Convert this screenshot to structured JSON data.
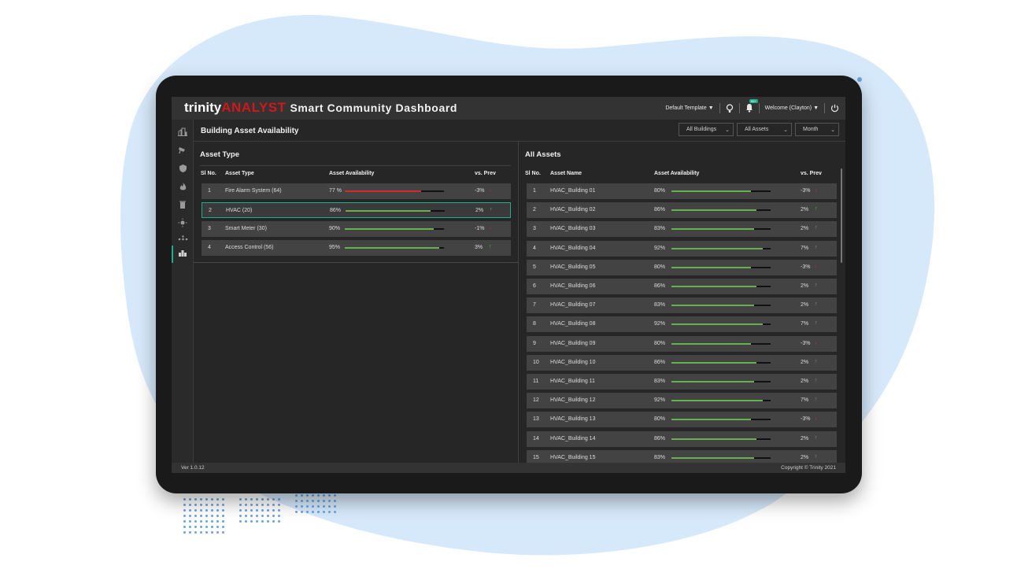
{
  "app": {
    "brand_part1": "trinity",
    "brand_part2": "ANALYST",
    "brand_part3": "Smart Community Dashboard"
  },
  "topbar": {
    "template_label": "Default Template",
    "notification_badge": "99+",
    "welcome_label": "Welcome (Clayton)"
  },
  "section": {
    "title": "Building Asset Availability"
  },
  "filters": {
    "buildings": "All Buildings",
    "assets": "All Assets",
    "period": "Month"
  },
  "left_panel": {
    "title": "Asset Type",
    "headers": {
      "sl": "Sl No.",
      "name": "Asset Type",
      "availability": "Asset Availability",
      "vs_prev": "vs. Prev"
    },
    "rows": [
      {
        "sl": "1",
        "name": "Fire Alarm System (64)",
        "availability_text": "77 %",
        "availability": 77,
        "bar_color": "#d62b2b",
        "vs_prev": "-3%",
        "trend": "down",
        "selected": false
      },
      {
        "sl": "2",
        "name": "HVAC (20)",
        "availability_text": "86%",
        "availability": 86,
        "bar_color": "#66b14f",
        "vs_prev": "2%",
        "trend": "up",
        "selected": true
      },
      {
        "sl": "3",
        "name": "Smart Meter (30)",
        "availability_text": "90%",
        "availability": 90,
        "bar_color": "#66b14f",
        "vs_prev": "-1%",
        "trend": "down",
        "selected": false
      },
      {
        "sl": "4",
        "name": "Access Control (56)",
        "availability_text": "95%",
        "availability": 95,
        "bar_color": "#66b14f",
        "vs_prev": "3%",
        "trend": "up",
        "selected": false
      }
    ]
  },
  "right_panel": {
    "title": "All Assets",
    "headers": {
      "sl": "Sl No.",
      "name": "Asset Name",
      "availability": "Asset Availability",
      "vs_prev": "vs. Prev"
    },
    "rows": [
      {
        "sl": "1",
        "name": "HVAC_Building 01",
        "availability_text": "80%",
        "availability": 80,
        "vs_prev": "-3%",
        "trend": "down"
      },
      {
        "sl": "2",
        "name": "HVAC_Building 02",
        "availability_text": "86%",
        "availability": 86,
        "vs_prev": "2%",
        "trend": "up"
      },
      {
        "sl": "3",
        "name": "HVAC_Building 03",
        "availability_text": "83%",
        "availability": 83,
        "vs_prev": "2%",
        "trend": "up"
      },
      {
        "sl": "4",
        "name": "HVAC_Building 04",
        "availability_text": "92%",
        "availability": 92,
        "vs_prev": "7%",
        "trend": "up"
      },
      {
        "sl": "5",
        "name": "HVAC_Building 05",
        "availability_text": "80%",
        "availability": 80,
        "vs_prev": "-3%",
        "trend": "down"
      },
      {
        "sl": "6",
        "name": "HVAC_Building 06",
        "availability_text": "86%",
        "availability": 86,
        "vs_prev": "2%",
        "trend": "up"
      },
      {
        "sl": "7",
        "name": "HVAC_Building 07",
        "availability_text": "83%",
        "availability": 83,
        "vs_prev": "2%",
        "trend": "up"
      },
      {
        "sl": "8",
        "name": "HVAC_Building 08",
        "availability_text": "92%",
        "availability": 92,
        "vs_prev": "7%",
        "trend": "up"
      },
      {
        "sl": "9",
        "name": "HVAC_Building 09",
        "availability_text": "80%",
        "availability": 80,
        "vs_prev": "-3%",
        "trend": "down"
      },
      {
        "sl": "10",
        "name": "HVAC_Building 10",
        "availability_text": "86%",
        "availability": 86,
        "vs_prev": "2%",
        "trend": "up"
      },
      {
        "sl": "11",
        "name": "HVAC_Building 11",
        "availability_text": "83%",
        "availability": 83,
        "vs_prev": "2%",
        "trend": "up"
      },
      {
        "sl": "12",
        "name": "HVAC_Building 12",
        "availability_text": "92%",
        "availability": 92,
        "vs_prev": "7%",
        "trend": "up"
      },
      {
        "sl": "13",
        "name": "HVAC_Building 13",
        "availability_text": "80%",
        "availability": 80,
        "vs_prev": "-3%",
        "trend": "down"
      },
      {
        "sl": "14",
        "name": "HVAC_Building 14",
        "availability_text": "86%",
        "availability": 86,
        "vs_prev": "2%",
        "trend": "up"
      },
      {
        "sl": "15",
        "name": "HVAC_Building 15",
        "availability_text": "83%",
        "availability": 83,
        "vs_prev": "2%",
        "trend": "up"
      }
    ]
  },
  "sidebar": {
    "icons": [
      "city-icon",
      "camera-icon",
      "shield-icon",
      "fire-icon",
      "trash-icon",
      "light-icon",
      "network-icon",
      "building-icon"
    ],
    "active_index": 7
  },
  "footer": {
    "version": "Ver 1.0.12",
    "copyright": "Copyright © Trinity 2021"
  },
  "colors": {
    "accent": "#1fae8a",
    "brand_red": "#d1171b",
    "good": "#66b14f",
    "bad": "#d62b2b"
  }
}
